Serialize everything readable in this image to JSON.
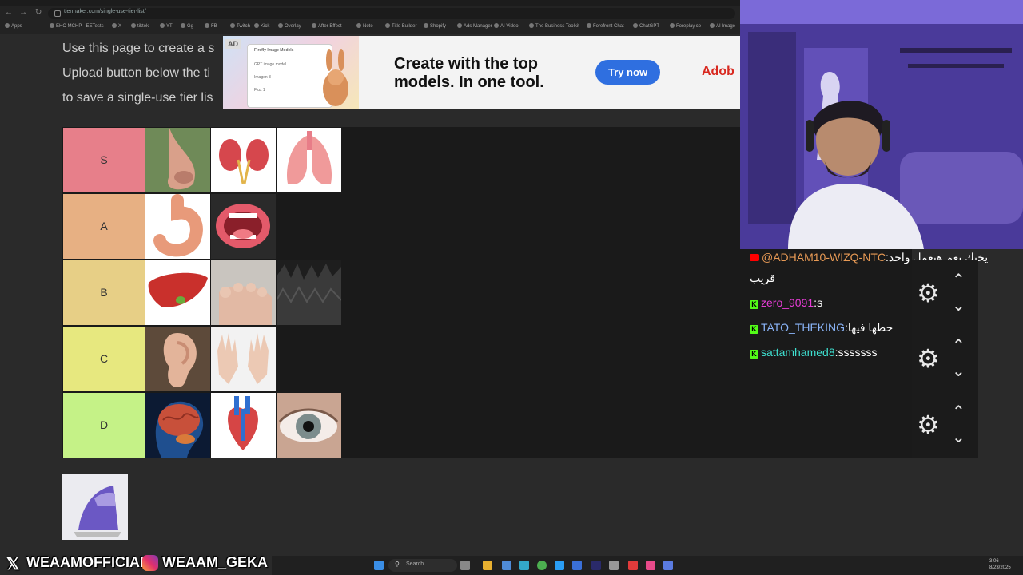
{
  "browser": {
    "url": "tiermaker.com/single-use-tier-list/",
    "bookmarks": [
      "Apps",
      "EHC-MCHP - EETests",
      "X",
      "tiktok",
      "YT",
      "Gg",
      "FB",
      "Twitch",
      "Kick",
      "Overlay",
      "After Effect",
      "Note",
      "Title Builder",
      "Shopify",
      "Ads Manager",
      "AI Video",
      "The Business Toolkit",
      "Forefront Chat",
      "ChatGPT",
      "Foreplay.co",
      "AI Image"
    ]
  },
  "page": {
    "intro_lines": [
      "Use this page to create a s",
      "Upload button below the ti",
      "to save a single-use tier lis"
    ]
  },
  "ad": {
    "badge": "AD",
    "mock_title": "Firefly Image Models",
    "mock_rows": [
      "GPT image model",
      "Imagen 3",
      "Flux 1"
    ],
    "headline": "Create with the top models. In one tool.",
    "button": "Try now",
    "brand": "Adob"
  },
  "tiers": [
    {
      "label": "S",
      "color": "#e77f8a",
      "items": [
        "nose",
        "kidneys",
        "lungs"
      ]
    },
    {
      "label": "A",
      "color": "#e7b083",
      "items": [
        "stomach",
        "mouth"
      ]
    },
    {
      "label": "B",
      "color": "#e7cf86",
      "items": [
        "liver",
        "toes",
        "hair"
      ]
    },
    {
      "label": "C",
      "color": "#e7e87f",
      "items": [
        "ear",
        "hands"
      ]
    },
    {
      "label": "D",
      "color": "#c5f287",
      "items": [
        "brain",
        "heart",
        "eye"
      ]
    }
  ],
  "pool": {
    "items": [
      "clothes-iron"
    ]
  },
  "chat": {
    "messages": [
      {
        "platform": "youtube",
        "user": "@ADHAM10-WIZQ-NTC",
        "user_color": "#e89a55",
        "text": "يختك يعم هتعمل واحد",
        "text2": "قريب"
      },
      {
        "platform": "kick",
        "user": "zero_9091",
        "user_color": "#e73cd6",
        "text": "s"
      },
      {
        "platform": "kick",
        "user": "TATO_THEKING",
        "user_color": "#8ab4f8",
        "text": "حطها فيها"
      },
      {
        "platform": "kick",
        "user": "sattamhamed8",
        "user_color": "#3ee0d0",
        "text": "sssssss"
      }
    ]
  },
  "socials": {
    "x_handle": "WEAAMOFFICIAL",
    "ig_handle": "WEAAM_GEKA"
  },
  "taskbar": {
    "search_label": "Search",
    "time": "3:06",
    "date": "8/23/2025"
  },
  "colors": {
    "page_bg": "#2a2a2a",
    "tier_bg": "#1a1a1a",
    "accent": "#2f6fe0"
  }
}
